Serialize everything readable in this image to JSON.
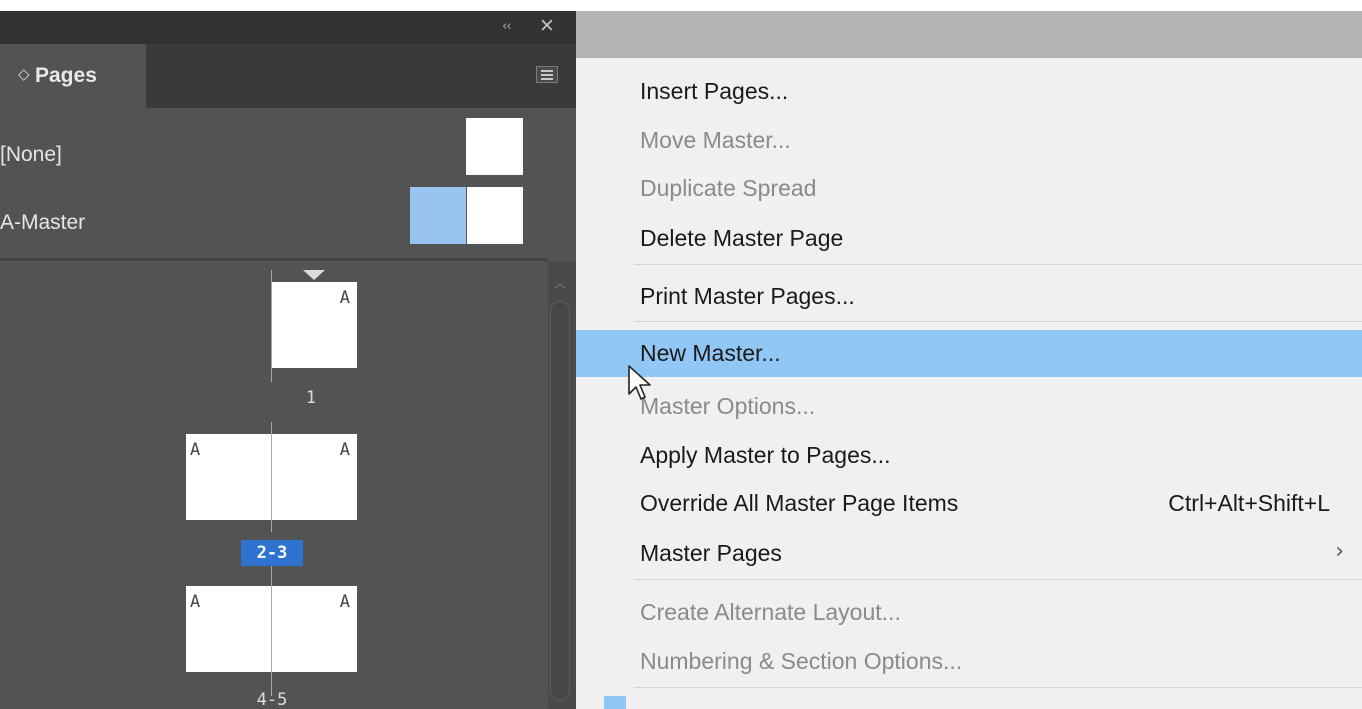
{
  "panel": {
    "collapse_glyph": "‹‹",
    "close_glyph": "✕",
    "tab_icon": "◇",
    "tab_label": "Pages",
    "masters": [
      {
        "label": "[None]"
      },
      {
        "label": "A-Master"
      }
    ],
    "pages": {
      "single_letter": "A",
      "page1_number": "1",
      "spread1_left_letter": "A",
      "spread1_right_letter": "A",
      "spread1_number": "2-3",
      "spread2_left_letter": "A",
      "spread2_right_letter": "A",
      "spread2_number": "4-5"
    }
  },
  "menu": {
    "items": [
      {
        "label": "Insert Pages...",
        "disabled": false
      },
      {
        "label": "Move Master...",
        "disabled": true
      },
      {
        "label": "Duplicate Spread",
        "disabled": true
      },
      {
        "label": "Delete Master Page",
        "disabled": false
      },
      {
        "label": "Print Master Pages...",
        "disabled": false
      },
      {
        "label": "New Master...",
        "disabled": false,
        "highlighted": true
      },
      {
        "label": "Master Options...",
        "disabled": true
      },
      {
        "label": "Apply Master to Pages...",
        "disabled": false
      },
      {
        "label": "Override All Master Page Items",
        "disabled": false,
        "shortcut": "Ctrl+Alt+Shift+L"
      },
      {
        "label": "Master Pages",
        "disabled": false,
        "submenu_arrow": "›"
      },
      {
        "label": "Create Alternate Layout...",
        "disabled": true
      },
      {
        "label": "Numbering & Section Options...",
        "disabled": true
      }
    ]
  },
  "colors": {
    "panel_bg": "#535353",
    "menu_bg": "#f0f0f0",
    "highlight": "#91c7f5",
    "selected_page": "#2f73d0",
    "master_thumb_blue": "#99c4ef"
  },
  "icons": {
    "panel_collapse": "double-chevron-left-icon",
    "panel_close": "close-icon",
    "tab_toggle": "diamond-toggle-icon",
    "panel_menu": "hamburger-menu-icon",
    "cursor": "mouse-pointer-icon"
  }
}
